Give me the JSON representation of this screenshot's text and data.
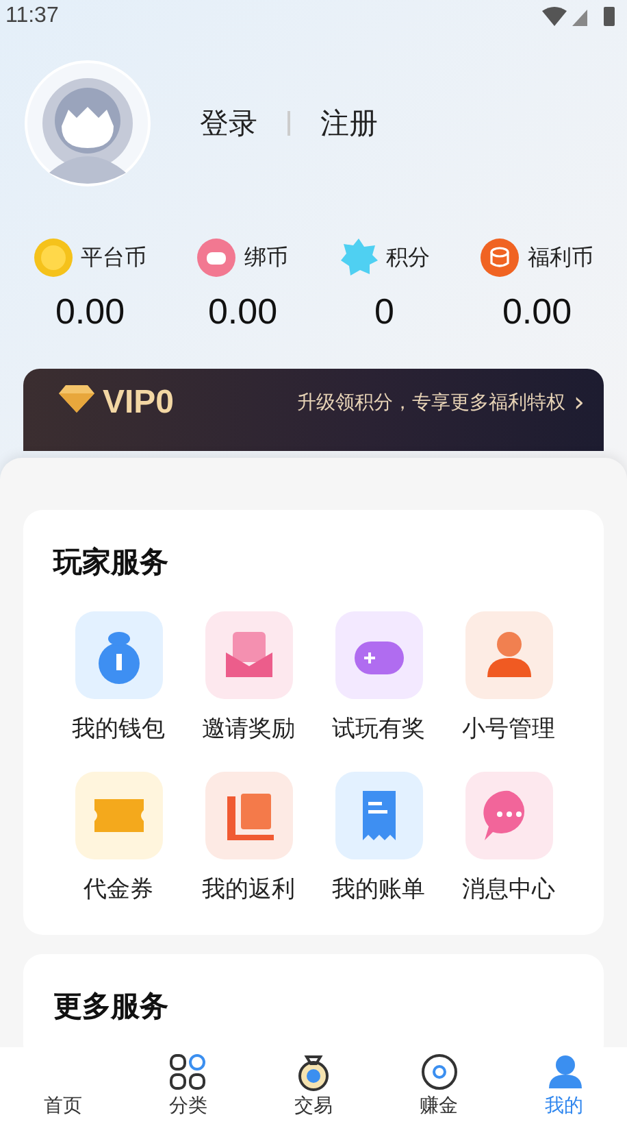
{
  "status_bar": {
    "time": "11:37"
  },
  "profile": {
    "login": "登录",
    "register": "注册"
  },
  "balances": [
    {
      "kind": "coin",
      "label": "平台币",
      "value": "0.00"
    },
    {
      "kind": "bound",
      "label": "绑币",
      "value": "0.00"
    },
    {
      "kind": "points",
      "label": "积分",
      "value": "0"
    },
    {
      "kind": "welfare",
      "label": "福利币",
      "value": "0.00"
    }
  ],
  "vip": {
    "level": "VIP0",
    "promo": "升级领积分，专享更多福利特权",
    "arrow": "›"
  },
  "player_services": {
    "title": "玩家服务",
    "items": [
      {
        "kind": "wallet",
        "label": "我的钱包"
      },
      {
        "kind": "invite",
        "label": "邀请奖励"
      },
      {
        "kind": "game",
        "label": "试玩有奖"
      },
      {
        "kind": "account",
        "label": "小号管理"
      },
      {
        "kind": "coupon",
        "label": "代金券"
      },
      {
        "kind": "rebate",
        "label": "我的返利"
      },
      {
        "kind": "bill",
        "label": "我的账单"
      },
      {
        "kind": "message",
        "label": "消息中心"
      }
    ]
  },
  "more_services": {
    "title": "更多服务"
  },
  "tabs": [
    {
      "kind": "home",
      "label": "首页",
      "selected": false
    },
    {
      "kind": "category",
      "label": "分类",
      "selected": false
    },
    {
      "kind": "trade",
      "label": "交易",
      "selected": false
    },
    {
      "kind": "earn",
      "label": "赚金",
      "selected": false
    },
    {
      "kind": "mine",
      "label": "我的",
      "selected": true
    }
  ]
}
